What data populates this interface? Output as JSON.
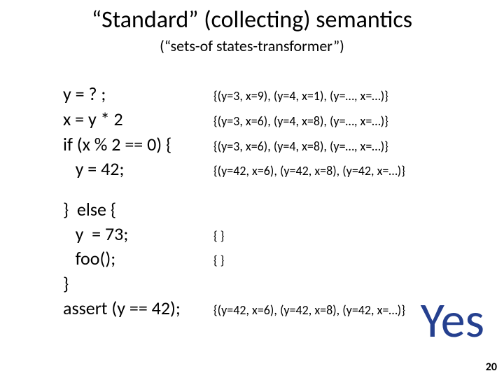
{
  "title": "“Standard” (collecting) semantics",
  "subtitle": "(“sets-of states-transformer”)",
  "rows": [
    {
      "code": "y = ? ;",
      "ann": "{(y=3, x=9), (y=4, x=1), (y=…, x=…)}"
    },
    {
      "code": "x = y * 2",
      "ann": "{(y=3, x=6), (y=4, x=8), (y=…, x=…)}"
    },
    {
      "code": "if (x % 2 == 0) {",
      "ann": "{(y=3, x=6), (y=4, x=8), (y=…, x=…)}"
    },
    {
      "code": "   y = 42;",
      "ann": "{(y=42, x=6), (y=42, x=8), (y=42, x=…)}"
    },
    {
      "gap": true
    },
    {
      "code": "}  else {",
      "ann": ""
    },
    {
      "code": "   y  = 73;",
      "ann": "{ }"
    },
    {
      "code": "   foo();",
      "ann": "{ }"
    },
    {
      "code": "}",
      "ann": ""
    },
    {
      "code": "assert (y == 42);",
      "ann": "{(y=42, x=6), (y=42, x=8), (y=42, x=…)}"
    }
  ],
  "yes": "Yes",
  "page": "20"
}
